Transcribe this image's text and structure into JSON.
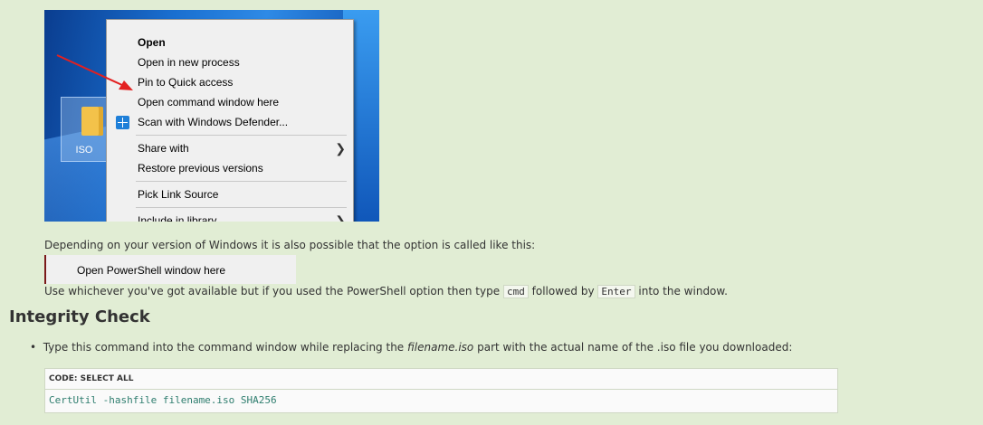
{
  "screenshot": {
    "desktop_icon_label": "ISO",
    "context_menu": {
      "items": [
        {
          "label": "Open",
          "bold": true
        },
        {
          "label": "Open in new process"
        },
        {
          "label": "Pin to Quick access"
        },
        {
          "label": "Open command window here"
        },
        {
          "label": "Scan with Windows Defender...",
          "icon": "windows-defender-icon"
        },
        {
          "label": "Share with",
          "submenu": true
        },
        {
          "label": "Restore previous versions"
        },
        {
          "label": "Pick Link Source"
        },
        {
          "label": "Include in library",
          "submenu": true
        }
      ],
      "highlight_arrow_color": "#e32020"
    }
  },
  "text": {
    "version_note": "Depending on your version of Windows it is also possible that the option is called like this:",
    "powershell_option": "Open PowerShell window here",
    "use_prefix": "Use whichever you've got available but if you used the PowerShell option then type",
    "cmd": "cmd",
    "followed_by": "followed by",
    "enter": "Enter",
    "into_window": "into the window."
  },
  "section": {
    "title": "Integrity Check",
    "bullet_prefix": "Type this command into the command window while replacing the",
    "bullet_em": "filename.iso",
    "bullet_suffix": "part with the actual name of the .iso file you downloaded:"
  },
  "code": {
    "header": "CODE: SELECT ALL",
    "command": "CertUtil -hashfile filename.iso SHA256"
  }
}
